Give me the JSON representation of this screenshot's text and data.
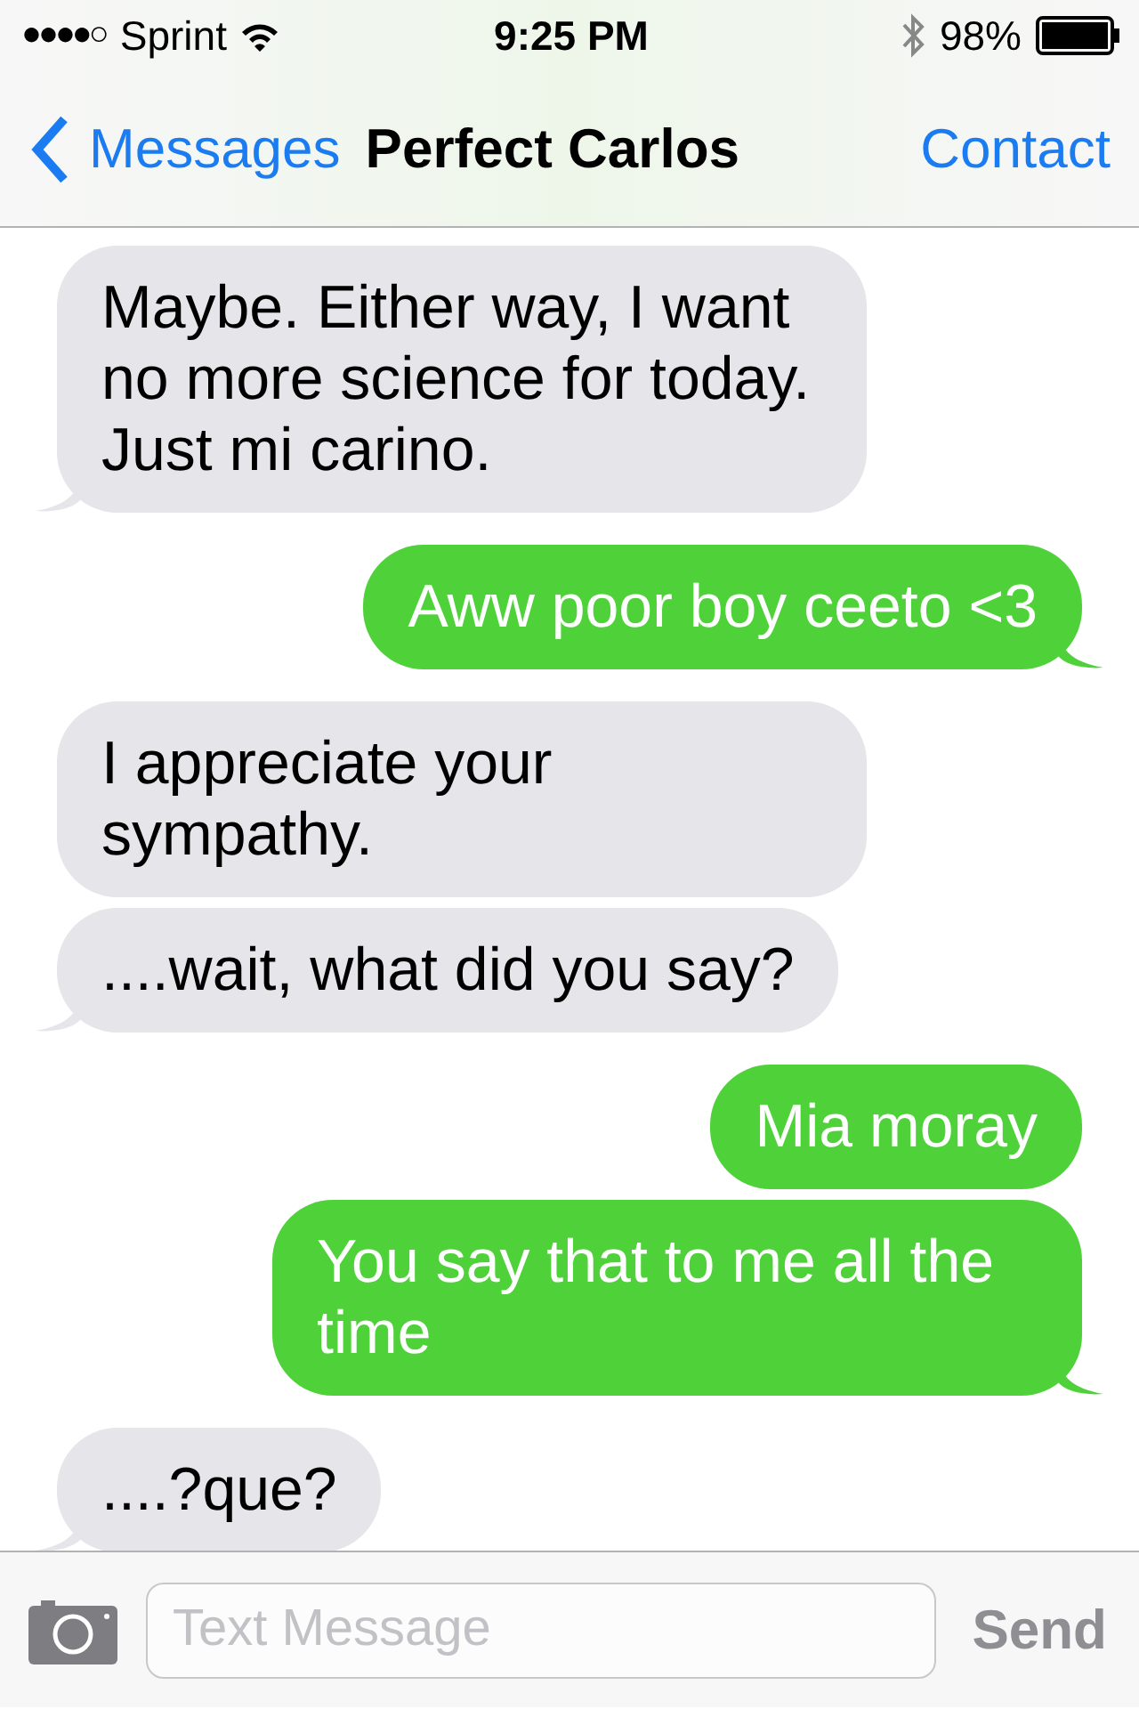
{
  "status_bar": {
    "carrier": "Sprint",
    "signal_bars": "●●●●○",
    "time": "9:25 PM",
    "battery": "98%"
  },
  "nav_bar": {
    "back": "Messages",
    "title": "Perfect Carlos",
    "action": "Contact"
  },
  "messages": [
    {
      "kind": "incoming",
      "text": "Maybe. Either way, I want no more science for today. Just mi carino.",
      "tail": true
    },
    {
      "kind": "outgoing",
      "text": "Aww poor boy ceeto <3",
      "tail": true
    },
    {
      "kind": "incoming",
      "text": "I appreciate your sympathy.",
      "tail": false
    },
    {
      "kind": "incoming",
      "text": "....wait, what did you say?",
      "tail": true
    },
    {
      "kind": "outgoing",
      "text": "Mia moray",
      "tail": false
    },
    {
      "kind": "outgoing",
      "text": "You say that to me all the time",
      "tail": true
    },
    {
      "kind": "incoming",
      "text": "....?que?",
      "tail": true
    }
  ],
  "composer": {
    "placeholder": "Text Message",
    "send": "Send",
    "send_disabled": true
  }
}
